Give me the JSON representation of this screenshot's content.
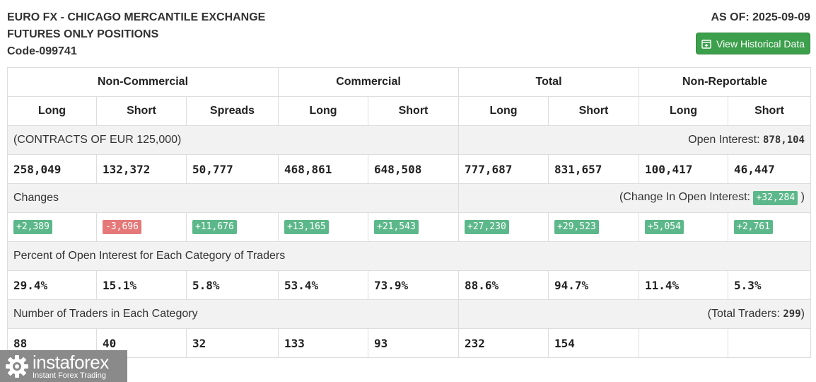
{
  "header": {
    "title_line1": "EURO FX - CHICAGO MERCANTILE EXCHANGE",
    "title_line2": "FUTURES ONLY POSITIONS",
    "code": "Code-099741",
    "as_of": "AS OF: 2025-09-09",
    "historical_button": "View Historical Data",
    "historical_icon": "calendar-plus-icon"
  },
  "table": {
    "groups": [
      "Non-Commercial",
      "Commercial",
      "Total",
      "Non-Reportable"
    ],
    "subheaders": [
      "Long",
      "Short",
      "Spreads",
      "Long",
      "Short",
      "Long",
      "Short",
      "Long",
      "Short"
    ],
    "contracts": {
      "label": "(CONTRACTS OF EUR 125,000)",
      "oi_label": "Open Interest:",
      "oi_value": "878,104",
      "values": [
        "258,049",
        "132,372",
        "50,777",
        "468,861",
        "648,508",
        "777,687",
        "831,657",
        "100,417",
        "46,447"
      ]
    },
    "changes": {
      "label": "Changes",
      "coi_prefix": "(Change In Open Interest:",
      "coi_value": "+32,284",
      "coi_suffix": ")",
      "values": [
        "+2,389",
        "-3,696",
        "+11,676",
        "+13,165",
        "+21,543",
        "+27,230",
        "+29,523",
        "+5,054",
        "+2,761"
      ]
    },
    "percent": {
      "label": "Percent of Open Interest for Each Category of Traders",
      "values": [
        "29.4%",
        "15.1%",
        "5.8%",
        "53.4%",
        "73.9%",
        "88.6%",
        "94.7%",
        "11.4%",
        "5.3%"
      ]
    },
    "traders": {
      "label": "Number of Traders in Each Category",
      "total_prefix": "(Total Traders:",
      "total_value": "299",
      "total_suffix": ")",
      "values": [
        "88",
        "40",
        "32",
        "133",
        "93",
        "232",
        "154",
        "",
        ""
      ]
    }
  },
  "logo": {
    "main": "instaforex",
    "sub": "Instant Forex Trading",
    "icon": "instaforex-gear-icon"
  },
  "colors": {
    "button_green": "#3c9f4c",
    "positive_badge": "#5cb88a",
    "negative_badge": "#e57878"
  }
}
